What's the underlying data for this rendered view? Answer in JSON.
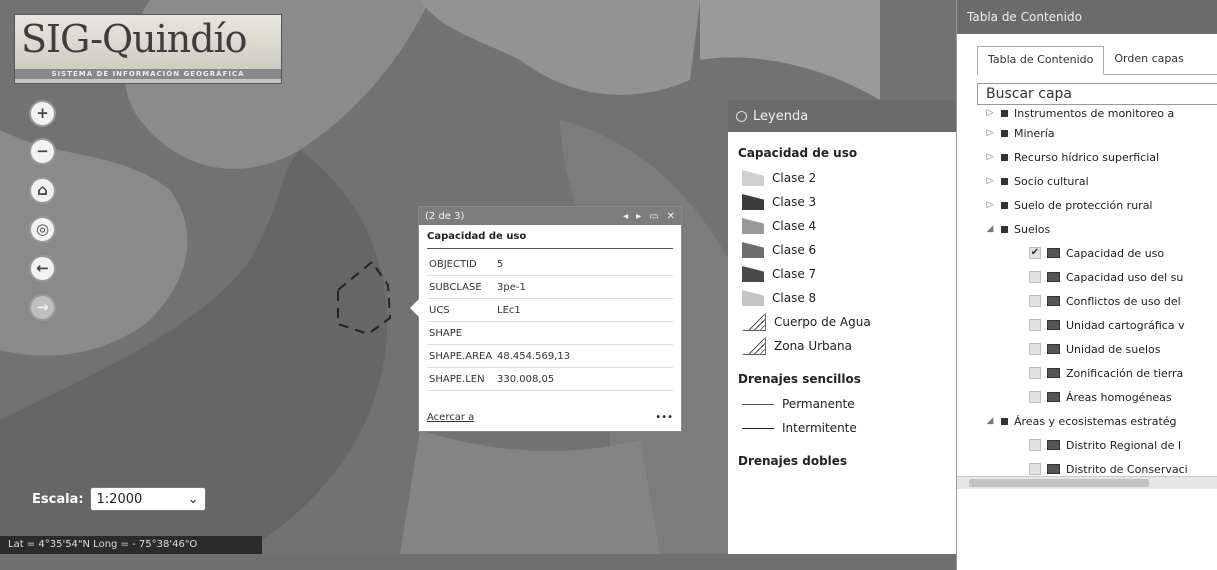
{
  "logo": {
    "title": "SIG-Quindío",
    "subtitle": "SISTEMA DE INFORMACIÓN GEOGRÁFICA"
  },
  "nav": {
    "zoom_in": "+",
    "zoom_out": "−",
    "home": "⌂",
    "locate": "◎",
    "back": "←",
    "forward": "→"
  },
  "scale": {
    "label": "Escala:",
    "value": "1:2000"
  },
  "coords": {
    "text": "Lat = 4°35'54\"N Long = - 75°38'46\"O"
  },
  "popup": {
    "counter": "(2 de 3)",
    "title": "Capacidad de uso",
    "rows": [
      {
        "k": "OBJECTID",
        "v": "5"
      },
      {
        "k": "SUBCLASE",
        "v": "3pe-1"
      },
      {
        "k": "UCS",
        "v": "LEc1"
      },
      {
        "k": "SHAPE",
        "v": ""
      },
      {
        "k": "SHAPE.AREA",
        "v": "48.454.569,13"
      },
      {
        "k": "SHAPE.LEN",
        "v": "330.008,05"
      }
    ],
    "zoom_link": "Acercar a",
    "more": "•••"
  },
  "legend": {
    "title": "Leyenda",
    "sections": [
      {
        "title": "Capacidad de uso",
        "items": [
          {
            "label": "Clase 2",
            "color": "#d0d0d0"
          },
          {
            "label": "Clase 3",
            "color": "#3c3c3c"
          },
          {
            "label": "Clase 4",
            "color": "#9a9a9a"
          },
          {
            "label": "Clase 6",
            "color": "#6c6c6c"
          },
          {
            "label": "Clase 7",
            "color": "#4a4a4a"
          },
          {
            "label": "Clase 8",
            "color": "#c4c4c4"
          },
          {
            "label": "Cuerpo de Agua",
            "color": "hatch"
          },
          {
            "label": "Zona Urbana",
            "color": "hatch"
          }
        ]
      },
      {
        "title": "Drenajes sencillos",
        "items": [
          {
            "label": "Permanente"
          },
          {
            "label": "Intermitente"
          }
        ]
      },
      {
        "title": "Drenajes dobles",
        "items": []
      }
    ]
  },
  "toc": {
    "window_title": "Tabla de Contenido",
    "tabs": [
      "Tabla de Contenido",
      "Orden capas"
    ],
    "search_placeholder": "Buscar capa",
    "groups": [
      "Instrumentos de monitoreo a",
      "Minería",
      "Recurso hídrico superficial",
      "Socio cultural",
      "Suelo de protección rural",
      "Suelos"
    ],
    "layers": [
      {
        "label": "Capacidad de uso",
        "checked": true
      },
      {
        "label": "Capacidad uso del su",
        "checked": false
      },
      {
        "label": "Conflictos de uso del",
        "checked": false
      },
      {
        "label": "Unidad cartográfica v",
        "checked": false
      },
      {
        "label": "Unidad de suelos",
        "checked": false
      },
      {
        "label": "Zonificación de tierra",
        "checked": false
      },
      {
        "label": "Áreas homogéneas",
        "checked": false
      }
    ],
    "group2": "Áreas y ecosistemas estratég",
    "layers2": [
      {
        "label": "Distrito Regional de I"
      },
      {
        "label": "Distrito de Conservaci"
      }
    ]
  }
}
